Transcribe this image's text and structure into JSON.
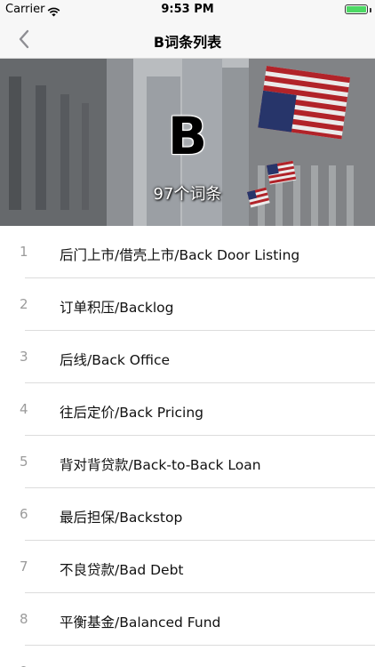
{
  "status_bar": {
    "carrier": "Carrier",
    "time": "9:53 PM",
    "battery_level": 1.0,
    "battery_color": "#4cd964"
  },
  "nav": {
    "title": "B词条列表",
    "back_icon": "chevron-left-icon"
  },
  "hero": {
    "letter": "B",
    "count_text": "97个词条"
  },
  "terms": [
    {
      "index": "1",
      "label": "后门上市/借壳上市/Back Door Listing"
    },
    {
      "index": "2",
      "label": "订单积压/Backlog"
    },
    {
      "index": "3",
      "label": "后线/Back Office"
    },
    {
      "index": "4",
      "label": "往后定价/Back Pricing"
    },
    {
      "index": "5",
      "label": "背对背贷款/Back-to-Back Loan"
    },
    {
      "index": "6",
      "label": "最后担保/Backstop"
    },
    {
      "index": "7",
      "label": "不良贷款/Bad Debt"
    },
    {
      "index": "8",
      "label": "平衡基金/Balanced Fund"
    },
    {
      "index": "9",
      "label": ""
    }
  ]
}
